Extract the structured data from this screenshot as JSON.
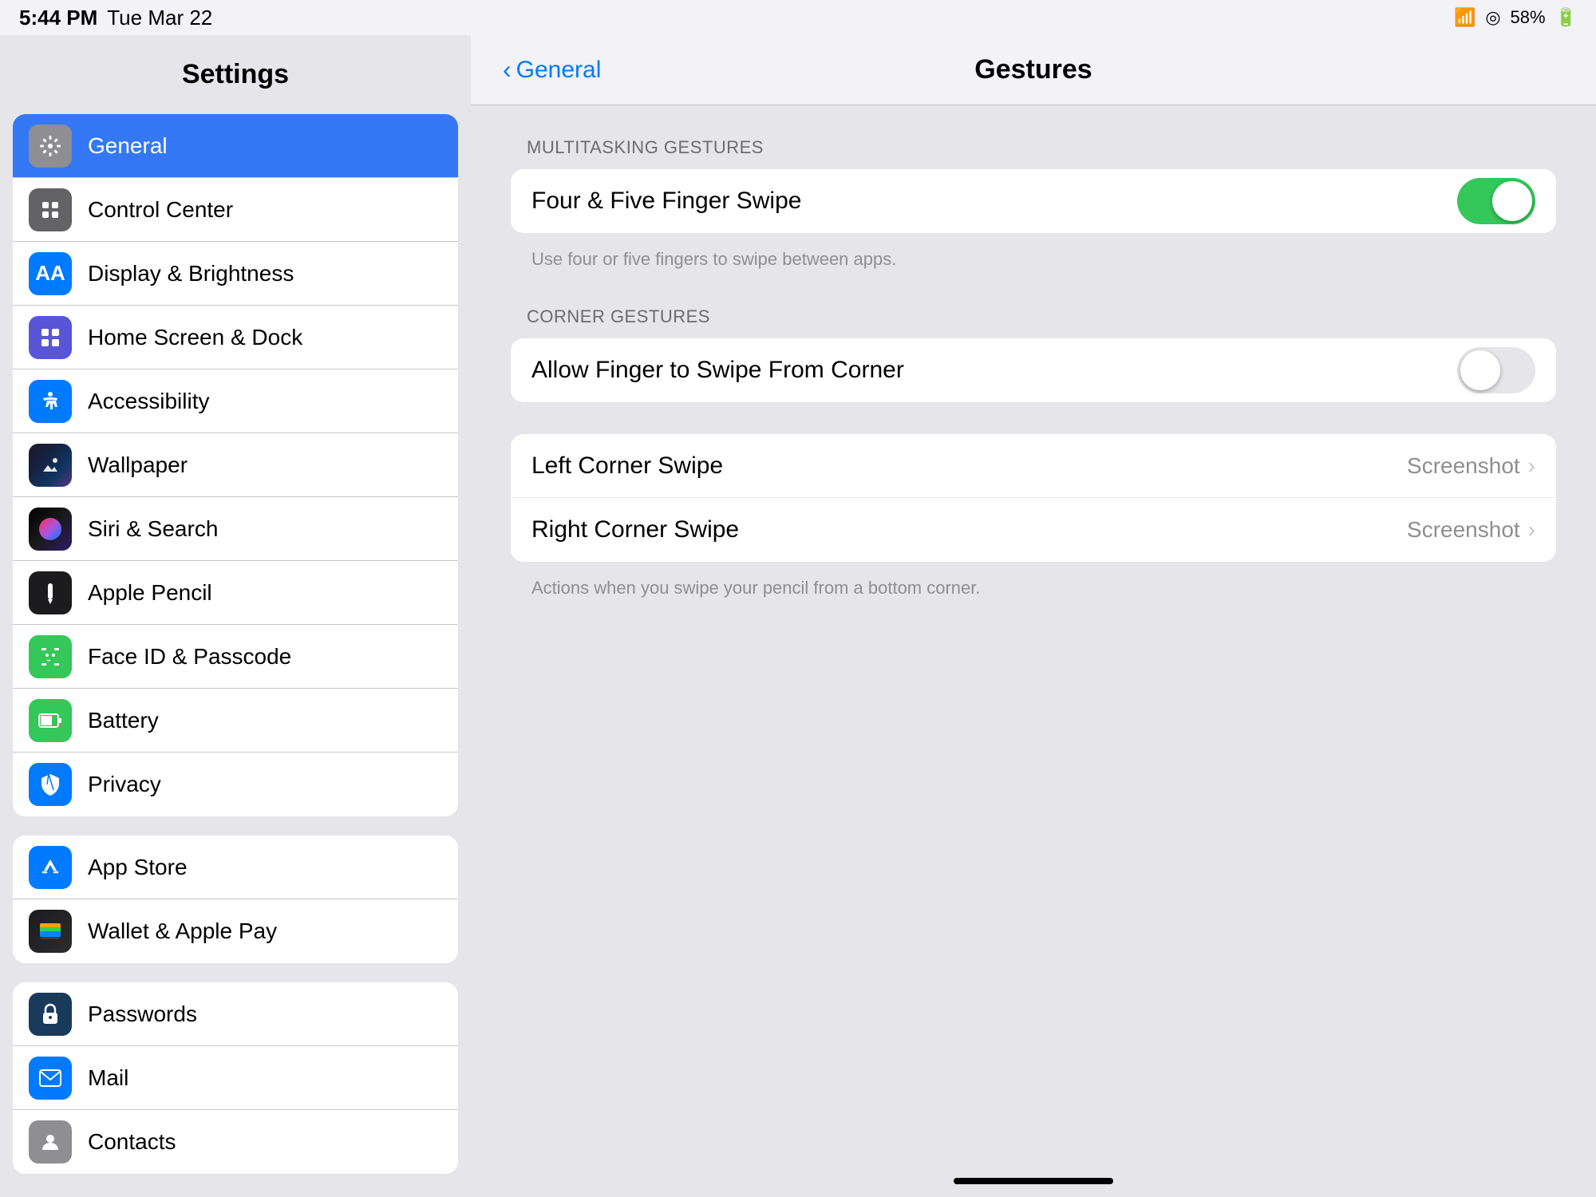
{
  "statusBar": {
    "time": "5:44 PM",
    "date": "Tue Mar 22",
    "battery": "58%"
  },
  "sidebar": {
    "title": "Settings",
    "groups": [
      {
        "items": [
          {
            "id": "general",
            "label": "General",
            "iconColor": "icon-gray",
            "iconChar": "⚙️",
            "active": true
          },
          {
            "id": "control-center",
            "label": "Control Center",
            "iconColor": "icon-gray",
            "iconChar": "⊞"
          },
          {
            "id": "display-brightness",
            "label": "Display & Brightness",
            "iconColor": "icon-blue",
            "iconChar": "AA"
          },
          {
            "id": "home-screen",
            "label": "Home Screen & Dock",
            "iconColor": "icon-indigo",
            "iconChar": "⊞"
          },
          {
            "id": "accessibility",
            "label": "Accessibility",
            "iconColor": "icon-blue2",
            "iconChar": "♿"
          },
          {
            "id": "wallpaper",
            "label": "Wallpaper",
            "iconColor": "icon-wallpaper",
            "iconChar": "🌸"
          },
          {
            "id": "siri-search",
            "label": "Siri & Search",
            "iconColor": "icon-siri",
            "iconChar": "◉"
          },
          {
            "id": "apple-pencil",
            "label": "Apple Pencil",
            "iconColor": "icon-dark",
            "iconChar": "✏️"
          },
          {
            "id": "face-id",
            "label": "Face ID & Passcode",
            "iconColor": "icon-green",
            "iconChar": "👤"
          },
          {
            "id": "battery",
            "label": "Battery",
            "iconColor": "icon-green",
            "iconChar": "🔋"
          },
          {
            "id": "privacy",
            "label": "Privacy",
            "iconColor": "icon-blue2",
            "iconChar": "✋"
          }
        ]
      },
      {
        "items": [
          {
            "id": "app-store",
            "label": "App Store",
            "iconColor": "icon-appstore",
            "iconChar": "A"
          },
          {
            "id": "wallet",
            "label": "Wallet & Apple Pay",
            "iconColor": "icon-wallet",
            "iconChar": "🃏"
          }
        ]
      },
      {
        "items": [
          {
            "id": "passwords",
            "label": "Passwords",
            "iconColor": "icon-darkblue",
            "iconChar": "🔑"
          },
          {
            "id": "mail",
            "label": "Mail",
            "iconColor": "icon-blue",
            "iconChar": "✉️"
          },
          {
            "id": "contacts",
            "label": "Contacts",
            "iconColor": "icon-gray",
            "iconChar": "👥"
          }
        ]
      }
    ]
  },
  "content": {
    "backLabel": "General",
    "title": "Gestures",
    "sections": [
      {
        "label": "MULTITASKING GESTURES",
        "items": [
          {
            "type": "toggle",
            "label": "Four & Five Finger Swipe",
            "value": true
          }
        ],
        "hint": "Use four or five fingers to swipe between apps."
      },
      {
        "label": "CORNER GESTURES",
        "items": [
          {
            "type": "toggle",
            "label": "Allow Finger to Swipe From Corner",
            "value": false
          }
        ]
      },
      {
        "label": "",
        "items": [
          {
            "type": "nav",
            "label": "Left Corner Swipe",
            "value": "Screenshot"
          },
          {
            "type": "nav",
            "label": "Right Corner Swipe",
            "value": "Screenshot"
          }
        ],
        "hint": "Actions when you swipe your pencil from a bottom corner."
      }
    ]
  }
}
